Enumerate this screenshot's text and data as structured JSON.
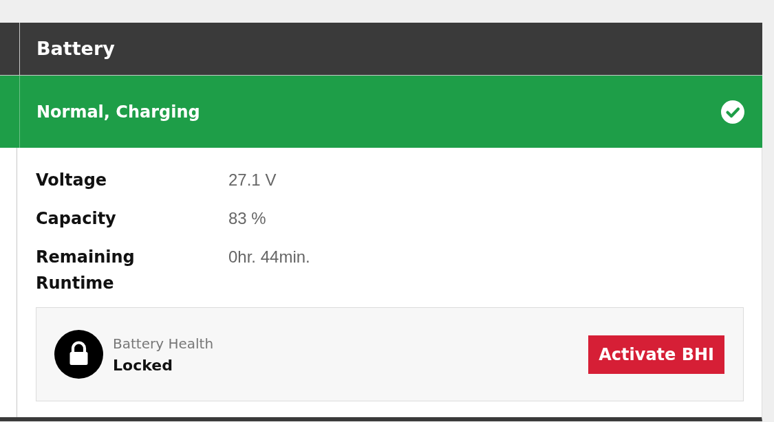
{
  "panel": {
    "title": "Battery",
    "status": {
      "text": "Normal, Charging",
      "ok": true
    },
    "metrics": [
      {
        "label": "Voltage",
        "value": "27.1 V"
      },
      {
        "label": "Capacity",
        "value": "83 %"
      },
      {
        "label": "Remaining Runtime",
        "value": "0hr. 44min."
      }
    ],
    "health": {
      "label": "Battery Health",
      "status": "Locked",
      "locked": true,
      "button": "Activate BHI"
    }
  }
}
